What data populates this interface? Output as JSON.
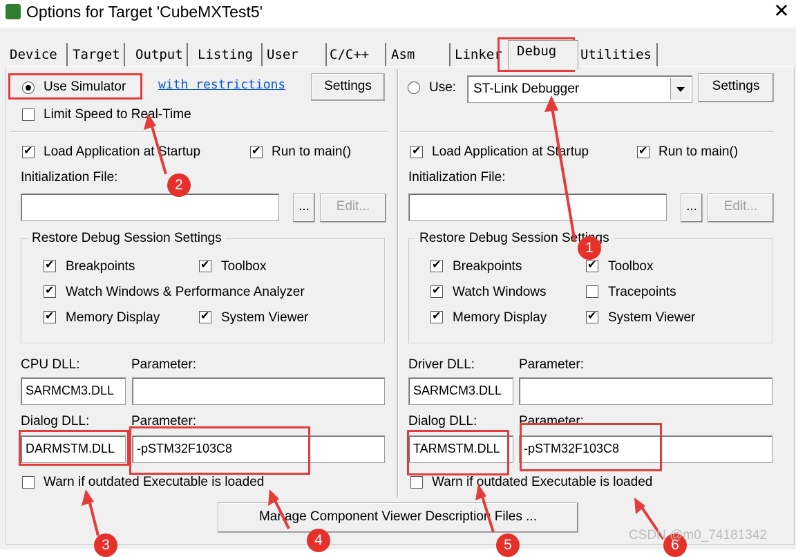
{
  "window": {
    "title": "Options for Target 'CubeMXTest5'",
    "close_glyph": "✕"
  },
  "tabs": [
    "Device",
    "Target",
    "Output",
    "Listing",
    "User",
    "C/C++",
    "Asm",
    "Linker",
    "Debug",
    "Utilities"
  ],
  "active_tab": "Debug",
  "left": {
    "use_simulator": "Use Simulator",
    "restrictions_link": "with restrictions",
    "settings": "Settings",
    "limit_speed": "Limit Speed to Real-Time",
    "load_app": "Load Application at Startup",
    "run_to_main": "Run to main()",
    "init_file_label": "Initialization File:",
    "init_file_value": "",
    "browse": "...",
    "edit": "Edit...",
    "restore_group": "Restore Debug Session Settings",
    "breakpoints": "Breakpoints",
    "toolbox": "Toolbox",
    "watch": "Watch Windows & Performance Analyzer",
    "memory": "Memory Display",
    "system_viewer": "System Viewer",
    "cpu_dll_label": "CPU DLL:",
    "cpu_param_label": "Parameter:",
    "cpu_dll_value": "SARMCM3.DLL",
    "cpu_param_value": "",
    "dialog_dll_label": "Dialog DLL:",
    "dialog_param_label": "Parameter:",
    "dialog_dll_value": "DARMSTM.DLL",
    "dialog_param_value": "-pSTM32F103C8",
    "warn": "Warn if outdated Executable is loaded"
  },
  "right": {
    "use": "Use:",
    "debugger": "ST-Link Debugger",
    "settings": "Settings",
    "load_app": "Load Application at Startup",
    "run_to_main": "Run to main()",
    "init_file_label": "Initialization File:",
    "init_file_value": "",
    "browse": "...",
    "edit": "Edit...",
    "restore_group": "Restore Debug Session Settings",
    "breakpoints": "Breakpoints",
    "toolbox": "Toolbox",
    "watch": "Watch Windows",
    "tracepoints": "Tracepoints",
    "memory": "Memory Display",
    "system_viewer": "System Viewer",
    "driver_dll_label": "Driver DLL:",
    "driver_param_label": "Parameter:",
    "driver_dll_value": "SARMCM3.DLL",
    "driver_param_value": "",
    "dialog_dll_label": "Dialog DLL:",
    "dialog_param_label": "Parameter:",
    "dialog_dll_value": "TARMSTM.DLL",
    "dialog_param_value": "-pSTM32F103C8",
    "warn": "Warn if outdated Executable is loaded"
  },
  "manage_button": "Manage Component Viewer Description Files ...",
  "annotations": [
    "1",
    "2",
    "3",
    "4",
    "5",
    "6"
  ],
  "watermark": "CSDN @m0_74181342",
  "colors": {
    "annotation_red": "#e43b3b",
    "link_blue": "#0a58ca",
    "dialog_bg": "#f0f0f0"
  }
}
